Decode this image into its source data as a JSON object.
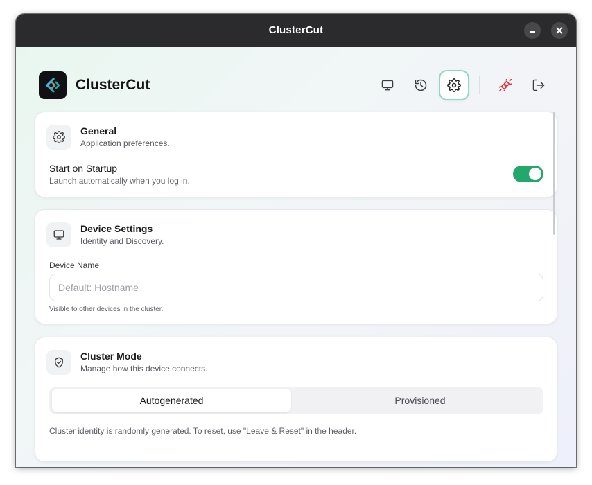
{
  "window": {
    "title": "ClusterCut"
  },
  "header": {
    "app_name": "ClusterCut",
    "nav": [
      {
        "icon": "monitor-icon",
        "active": false
      },
      {
        "icon": "history-icon",
        "active": false
      },
      {
        "icon": "gear-icon",
        "active": true
      },
      {
        "icon": "disconnect-plug-icon",
        "active": false,
        "color": "#e0343a"
      },
      {
        "icon": "logout-icon",
        "active": false
      }
    ]
  },
  "general": {
    "title": "General",
    "subtitle": "Application preferences.",
    "startup": {
      "label": "Start on Startup",
      "description": "Launch automatically when you log in.",
      "enabled": true
    }
  },
  "device": {
    "title": "Device Settings",
    "subtitle": "Identity and Discovery.",
    "name_label": "Device Name",
    "name_value": "",
    "name_placeholder": "Default: Hostname",
    "name_hint": "Visible to other devices in the cluster."
  },
  "cluster": {
    "title": "Cluster Mode",
    "subtitle": "Manage how this device connects.",
    "options": [
      "Autogenerated",
      "Provisioned"
    ],
    "selected": "Autogenerated",
    "note": "Cluster identity is randomly generated. To reset, use \"Leave & Reset\" in the header."
  },
  "colors": {
    "accent": "#22a86b",
    "active_border": "#8fd8c4",
    "danger": "#e0343a",
    "titlebar": "#2b2b2e"
  }
}
